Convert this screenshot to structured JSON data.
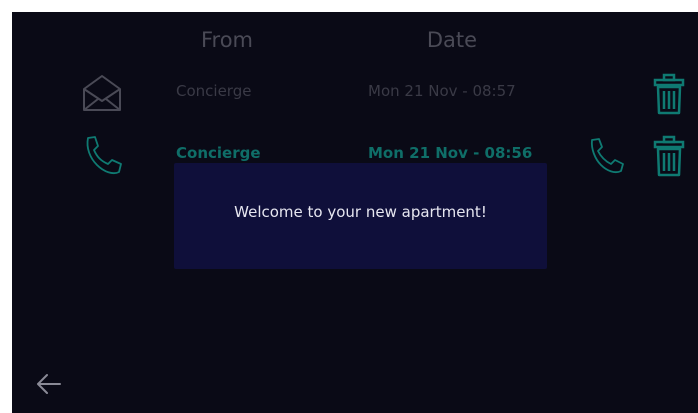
{
  "table": {
    "headers": {
      "from": "From",
      "date": "Date"
    },
    "rows": [
      {
        "type_icon": "envelope-open-icon",
        "from": "Concierge",
        "date": "Mon 21 Nov - 08:57",
        "unread": false,
        "actions": [
          "trash-icon"
        ]
      },
      {
        "type_icon": "phone-icon",
        "from": "Concierge",
        "date": "Mon 21 Nov - 08:56",
        "unread": true,
        "actions": [
          "phone-icon",
          "trash-icon"
        ]
      }
    ]
  },
  "message": {
    "text": "Welcome to your new apartment!"
  },
  "nav": {
    "back_icon": "arrow-left-icon"
  },
  "colors": {
    "background": "#0a0a16",
    "accent": "#0f7a72",
    "dim_text": "#3a3a46",
    "header_text": "#4a4a56",
    "dialog_background": "#0f0f3a",
    "dialog_text": "#e6e6f0"
  }
}
